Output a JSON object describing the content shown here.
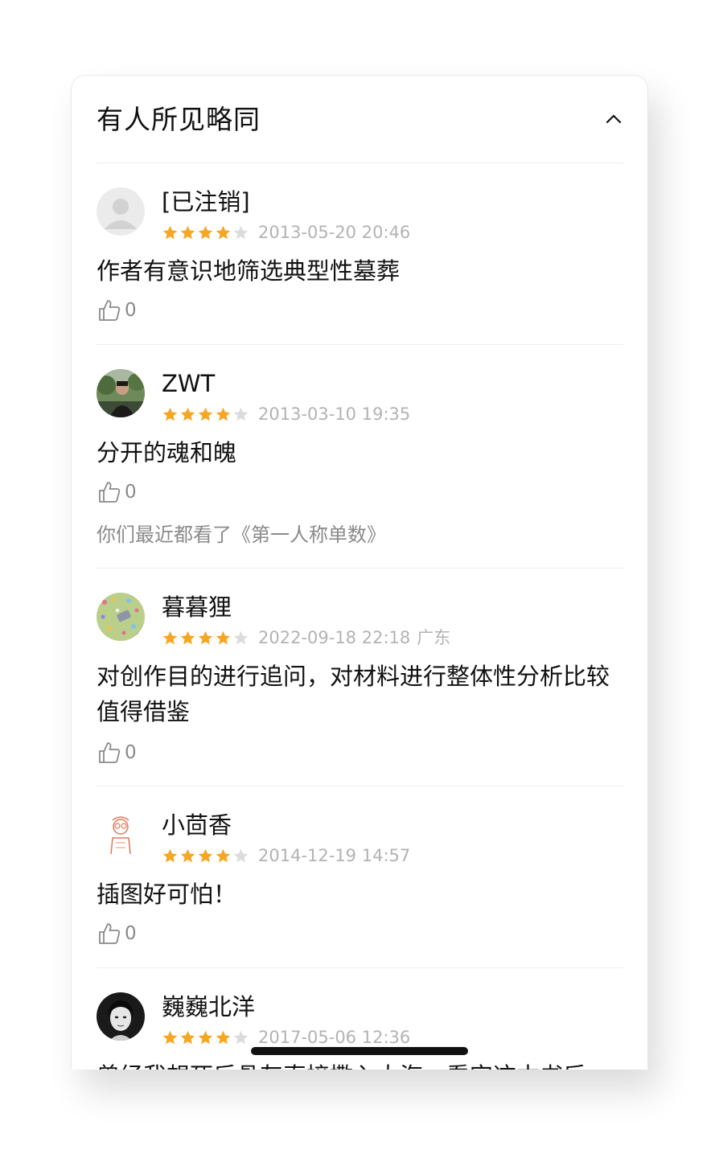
{
  "section": {
    "title": "有人所见略同",
    "collapse_icon": "chevron-up-icon"
  },
  "colors": {
    "star_filled": "#f5a623",
    "star_empty": "#dcdcdc",
    "muted_text": "#b3b3b3"
  },
  "reviews": [
    {
      "username": "[已注销]",
      "avatar": "default-avatar-icon",
      "rating": 4,
      "max_rating": 5,
      "timestamp": "2013-05-20 20:46",
      "location": "",
      "comment": "作者有意识地筛选典型性墓葬",
      "likes": "0",
      "related_link": ""
    },
    {
      "username": "ZWT",
      "avatar": "user-photo-avatar",
      "rating": 4,
      "max_rating": 5,
      "timestamp": "2013-03-10 19:35",
      "location": "",
      "comment": "分开的魂和魄",
      "likes": "0",
      "related_link": "你们最近都看了《第一人称单数》"
    },
    {
      "username": "暮暮狸",
      "avatar": "confetti-avatar",
      "rating": 4,
      "max_rating": 5,
      "timestamp": "2022-09-18 22:18",
      "location": "广东",
      "comment": "对创作目的进行追问，对材料进行整体性分析比较值得借鉴",
      "likes": "0",
      "related_link": ""
    },
    {
      "username": "小茴香",
      "avatar": "sketch-figure-avatar",
      "rating": 4,
      "max_rating": 5,
      "timestamp": "2014-12-19 14:57",
      "location": "",
      "comment": "插图好可怕！",
      "likes": "0",
      "related_link": ""
    },
    {
      "username": "巍巍北洋",
      "avatar": "portrait-photo-avatar",
      "rating": 4,
      "max_rating": 5,
      "timestamp": "2017-05-06 12:36",
      "location": "",
      "comment": "曾经我想死后骨灰直接撒入大海，看完这本书后",
      "likes": "",
      "related_link": ""
    }
  ]
}
